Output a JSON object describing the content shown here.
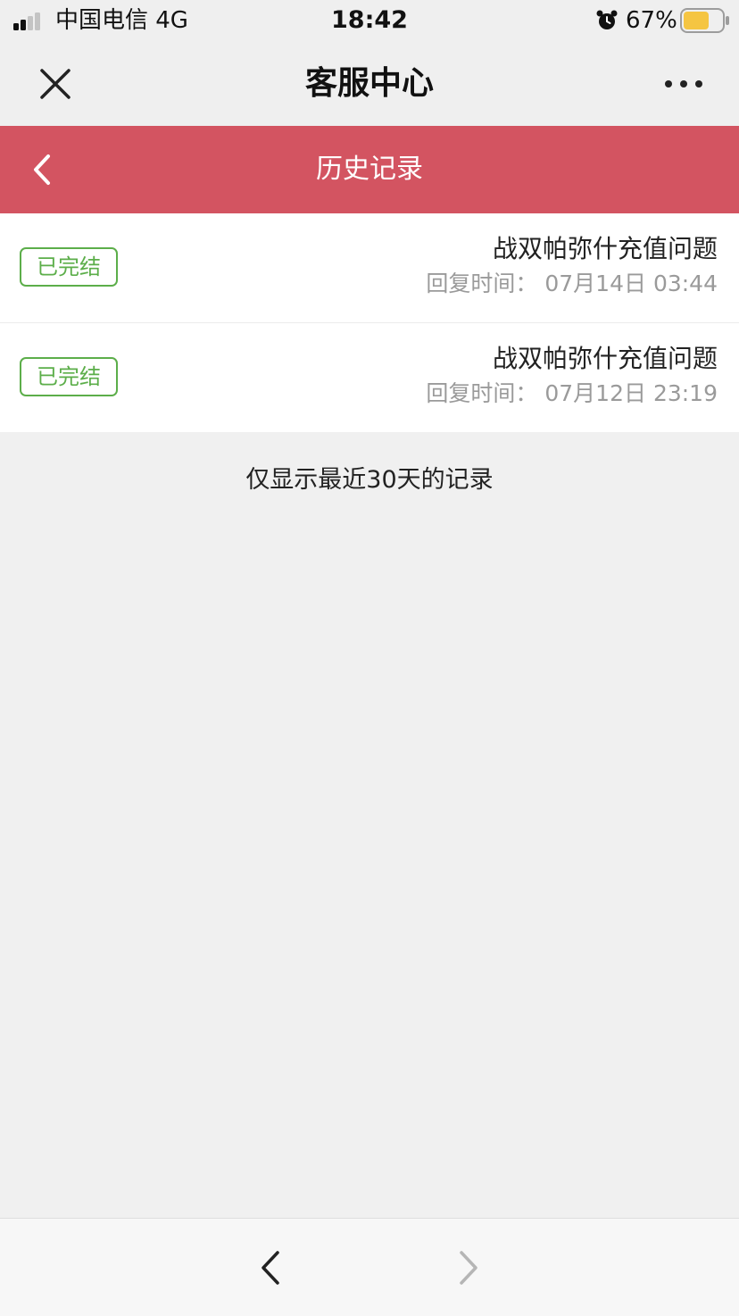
{
  "status_bar": {
    "carrier": "中国电信   4G",
    "time": "18:42",
    "battery_percent": "67%",
    "battery_level": 0.67,
    "signal_bars": 2
  },
  "nav": {
    "title": "客服中心",
    "close_icon": "close-icon",
    "more_icon": "more-dots-icon"
  },
  "header": {
    "title": "历史记录",
    "back_icon": "chevron-left-icon",
    "color": "#d35461"
  },
  "records": [
    {
      "status": "已完结",
      "title": "战双帕弥什充值问题",
      "reply_time": "回复时间：  07月14日 03:44"
    },
    {
      "status": "已完结",
      "title": "战双帕弥什充值问题",
      "reply_time": "回复时间：  07月12日 23:19"
    }
  ],
  "footnote": "仅显示最近30天的记录",
  "toolbar": {
    "back_icon": "chevron-left-icon",
    "forward_icon": "chevron-right-icon"
  },
  "colors": {
    "badge": "#5cae4a",
    "battery_fill": "#f5c542"
  }
}
